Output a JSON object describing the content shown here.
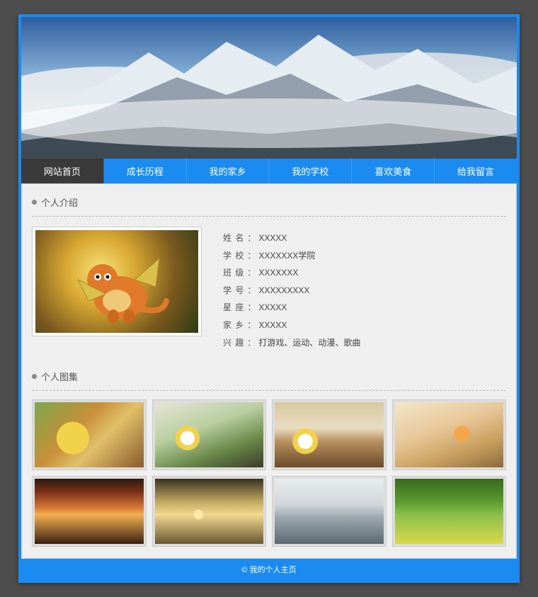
{
  "nav": {
    "items": [
      {
        "label": "网站首页",
        "active": true
      },
      {
        "label": "成长历程",
        "active": false
      },
      {
        "label": "我的家乡",
        "active": false
      },
      {
        "label": "我的学校",
        "active": false
      },
      {
        "label": "喜欢美食",
        "active": false
      },
      {
        "label": "给我留言",
        "active": false
      }
    ]
  },
  "sections": {
    "intro_title": "个人介绍",
    "gallery_title": "个人图集"
  },
  "profile": {
    "fields": [
      {
        "label": "姓 名",
        "value": "XXXXX"
      },
      {
        "label": "学 校",
        "value": "XXXXXXX学院"
      },
      {
        "label": "班 级",
        "value": "XXXXXXX"
      },
      {
        "label": "学 号",
        "value": "XXXXXXXXX"
      },
      {
        "label": "星 座",
        "value": "XXXXX"
      },
      {
        "label": "家 乡",
        "value": "XXXXX"
      },
      {
        "label": "兴 趣",
        "value": "打游戏、运动、动漫、歌曲"
      }
    ]
  },
  "gallery": {
    "items": [
      {
        "name": "food-1"
      },
      {
        "name": "food-2"
      },
      {
        "name": "food-3"
      },
      {
        "name": "food-4"
      },
      {
        "name": "scenery-sunset-1"
      },
      {
        "name": "scenery-sunset-2"
      },
      {
        "name": "scenery-snow"
      },
      {
        "name": "scenery-trees"
      }
    ]
  },
  "footer": {
    "text": "© 我的个人主页"
  }
}
